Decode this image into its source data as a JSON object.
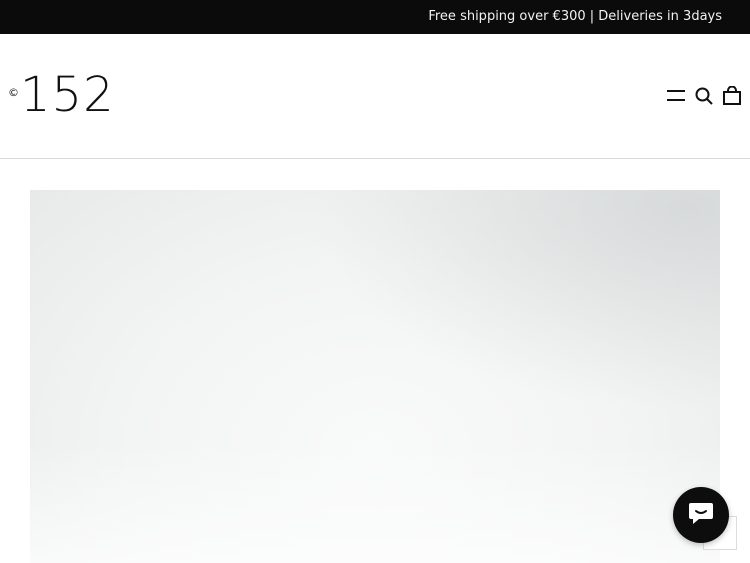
{
  "announcement": {
    "text": "Free shipping over €300 | Deliveries in 3days"
  },
  "header": {
    "logo": {
      "copyright_symbol": "©",
      "number": "152"
    },
    "icons": {
      "menu": "menu-icon",
      "search": "search-icon",
      "cart": "cart-icon"
    }
  },
  "hero": {
    "image": "hero-banner-image"
  },
  "chat": {
    "icon": "chat-icon"
  },
  "colors": {
    "announcement_bg": "#0b0b0b",
    "announcement_text": "#f2f2f2",
    "page_bg": "#ffffff",
    "chat_bg": "#0d0d0d"
  }
}
